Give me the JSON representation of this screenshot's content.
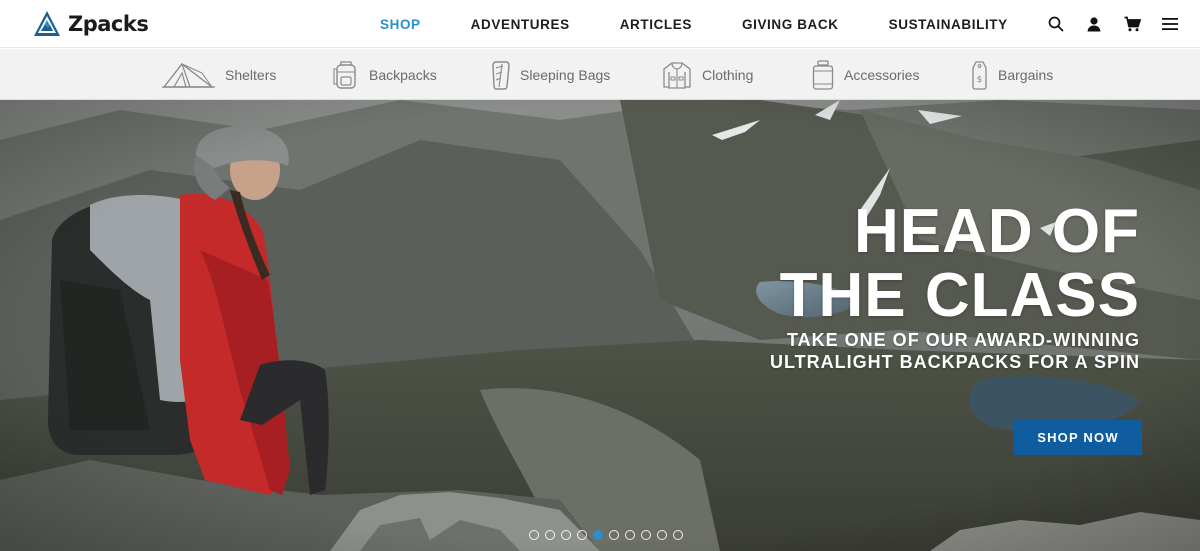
{
  "brand": {
    "name": "Zpacks",
    "logo_icon": "mountain-logo-icon",
    "accent_color": "#2a8fce"
  },
  "nav": {
    "items": [
      {
        "label": "SHOP",
        "active": true
      },
      {
        "label": "ADVENTURES",
        "active": false
      },
      {
        "label": "ARTICLES",
        "active": false
      },
      {
        "label": "GIVING BACK",
        "active": false
      },
      {
        "label": "SUSTAINABILITY",
        "active": false
      }
    ],
    "utility_icons": [
      "search-icon",
      "account-icon",
      "cart-icon",
      "menu-icon"
    ]
  },
  "categories": [
    {
      "label": "Shelters",
      "icon": "tent-icon"
    },
    {
      "label": "Backpacks",
      "icon": "backpack-icon"
    },
    {
      "label": "Sleeping Bags",
      "icon": "sleeping-bag-icon"
    },
    {
      "label": "Clothing",
      "icon": "jacket-icon"
    },
    {
      "label": "Accessories",
      "icon": "bottle-icon"
    },
    {
      "label": "Bargains",
      "icon": "price-tag-icon"
    }
  ],
  "hero": {
    "title_line1": "HEAD OF",
    "title_line2": "THE CLASS",
    "subtitle_line1": "TAKE ONE OF OUR AWARD-WINNING",
    "subtitle_line2": "ULTRALIGHT BACKPACKS FOR A SPIN",
    "cta_label": "SHOP NOW",
    "cta_color": "#0f5d9e",
    "carousel": {
      "total_slides": 10,
      "active_slide": 5
    }
  }
}
